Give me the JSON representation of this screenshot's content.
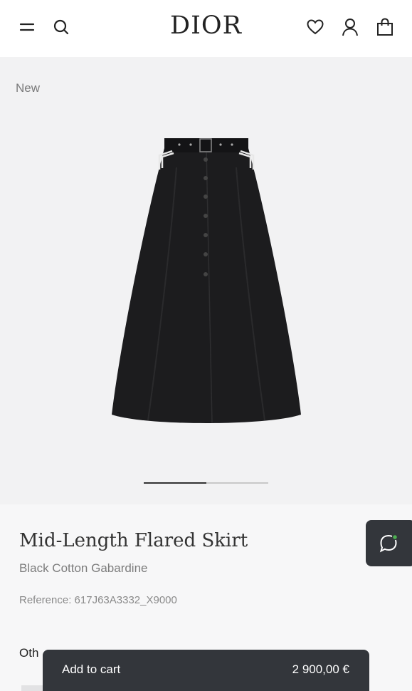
{
  "header": {
    "brand": "DIOR",
    "icons": [
      "menu-icon",
      "search-icon",
      "heart-icon",
      "user-icon",
      "shopping-bag-icon"
    ]
  },
  "gallery": {
    "badge": "New",
    "image": "black-flared-skirt",
    "progress": 0.5
  },
  "product": {
    "title": "Mid-Length Flared Skirt",
    "subtitle": "Black Cotton Gabardine",
    "reference": "Reference: 617J63A3332_X9000",
    "other_label_visible": "Oth"
  },
  "chat": {
    "icon": "chat-bubble-icon",
    "status_color": "#4caf50"
  },
  "cart": {
    "label": "Add to cart",
    "price": "2 900,00 €"
  },
  "colors": {
    "dark": "#33363b",
    "gallery_bg": "#f2f2f3",
    "info_bg": "#f7f7f8"
  }
}
